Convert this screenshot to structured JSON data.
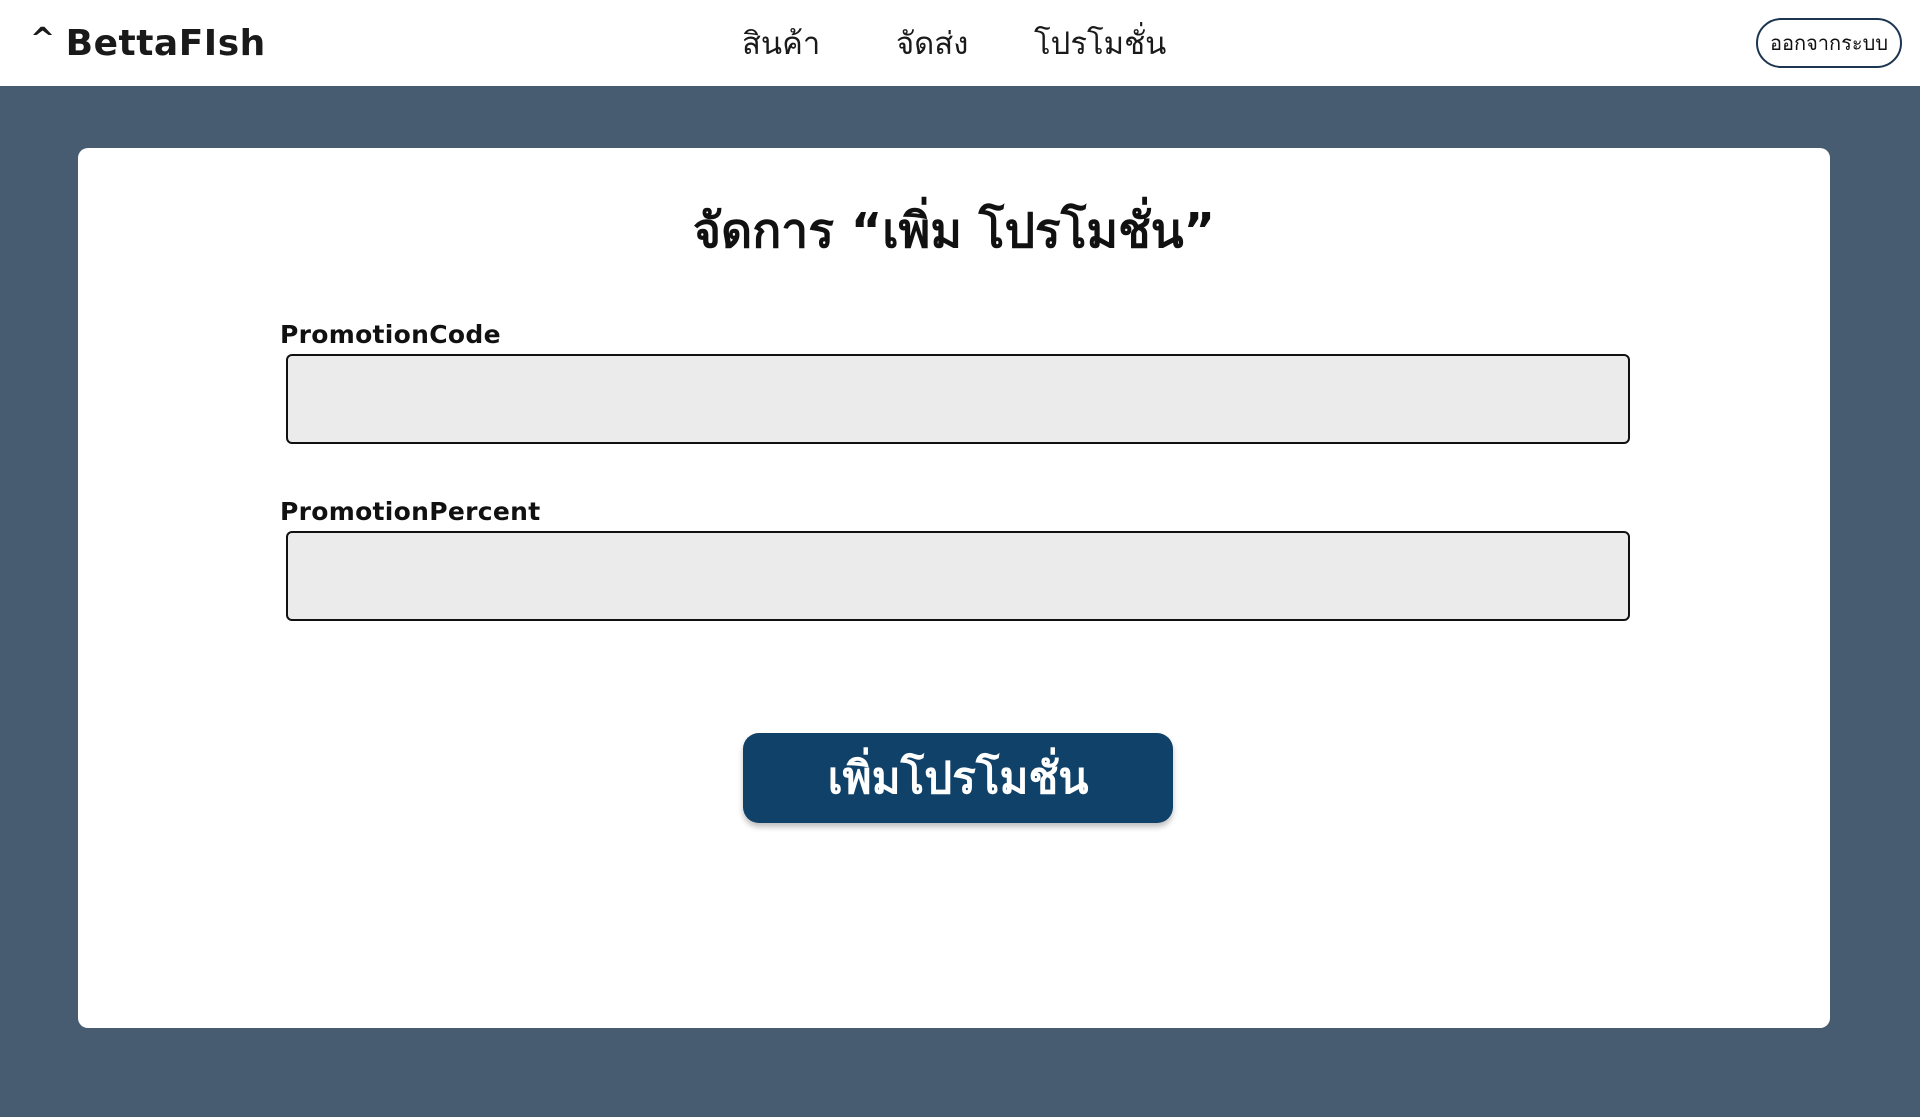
{
  "header": {
    "brand_caret": "^",
    "brand_name": "BettaFIsh",
    "nav": {
      "products": "สินค้า",
      "shipping": "จัดส่ง",
      "promotions": "โปรโมชั่น"
    },
    "logout_label": "ออกจากระบบ"
  },
  "form": {
    "title": "จัดการ “เพิ่ม โปรโมชั่น”",
    "promotion_code": {
      "label": "PromotionCode",
      "value": "",
      "placeholder": ""
    },
    "promotion_percent": {
      "label": "PromotionPercent",
      "value": "",
      "placeholder": ""
    },
    "submit_label": "เพิ่มโปรโมชั่น"
  },
  "colors": {
    "background": "#475c70",
    "header_bg": "#ffffff",
    "card_bg": "#ffffff",
    "input_bg": "#ebebeb",
    "button_bg": "#0f4169",
    "logout_border": "#1c3550"
  }
}
